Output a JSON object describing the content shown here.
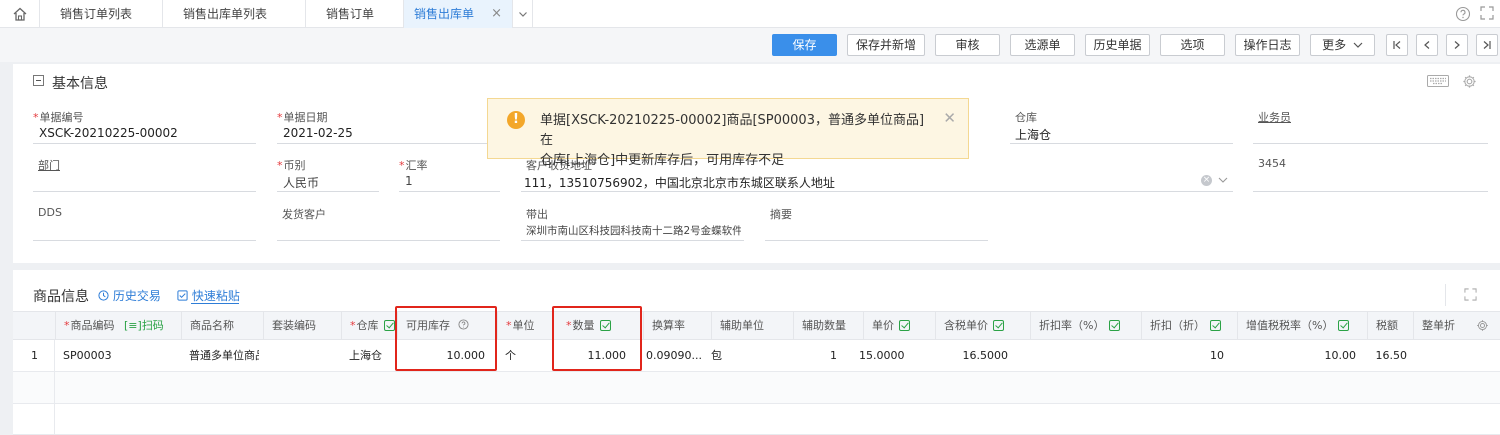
{
  "tabs": [
    {
      "label": "销售订单列表"
    },
    {
      "label": "销售出库单列表"
    },
    {
      "label": "销售订单"
    },
    {
      "label": "销售出库单",
      "close": "×"
    }
  ],
  "toolbar": {
    "save": "保存",
    "save_new": "保存并新增",
    "audit": "审核",
    "select_source": "选源单",
    "history_docs": "历史单据",
    "options": "选项",
    "op_log": "操作日志",
    "more": "更多"
  },
  "basic": {
    "title": "基本信息",
    "fields": {
      "doc_no": {
        "label": "单据编号",
        "value": "XSCK-20210225-00002"
      },
      "doc_date": {
        "label": "单据日期",
        "value": "2021-02-25"
      },
      "warehouse": {
        "label": "仓库",
        "value": "上海仓"
      },
      "salesman": {
        "label": "业务员",
        "value": ""
      },
      "dept": {
        "label": "部门",
        "value": ""
      },
      "currency": {
        "label": "币别",
        "value": "人民币"
      },
      "rate": {
        "label": "汇率",
        "value": "1"
      },
      "address": {
        "label": "客户收货地址",
        "value": "111，13510756902，中国北京北京市东城区联系人地址"
      },
      "custom1": {
        "label": "3454",
        "value": ""
      },
      "dds": {
        "label": "DDS",
        "value": ""
      },
      "ship_customer": {
        "label": "发货客户",
        "value": ""
      },
      "bring_out": {
        "label": "带出",
        "value": "深圳市南山区科技园科技南十二路2号金蝶软件..."
      },
      "summary": {
        "label": "摘要",
        "value": ""
      }
    }
  },
  "alert": {
    "line1": "单据[XSCK-20210225-00002]商品[SP00003，普通多单位商品]在",
    "line2": "仓库[上海仓]中更新库存后，可用库存不足"
  },
  "goods": {
    "title": "商品信息",
    "history_trade": "历史交易",
    "quick_paste": "快速粘贴",
    "columns": {
      "code": "商品编码",
      "scan": "扫码",
      "name": "商品名称",
      "set_code": "套装编码",
      "warehouse": "仓库",
      "avail_stock": "可用库存",
      "unit": "单位",
      "qty": "数量",
      "conv_rate": "换算率",
      "aux_unit": "辅助单位",
      "aux_qty": "辅助数量",
      "price": "单价",
      "tax_price": "含税单价",
      "discount_rate": "折扣率（%）",
      "discount": "折扣（折）",
      "vat_rate": "增值税税率（%）",
      "tax_amount": "税额",
      "whole_disc": "整单折"
    },
    "rows": [
      {
        "idx": "1",
        "code": "SP00003",
        "name": "普通多单位商品",
        "warehouse": "上海仓",
        "avail_stock": "10.000",
        "unit": "个",
        "qty": "11.000",
        "conv_rate": "0.09090...",
        "aux_unit": "包",
        "aux_qty": "1",
        "price": "15.0000",
        "tax_price": "16.5000",
        "discount": "10",
        "vat_rate": "10.00",
        "tax_amount": "16.50"
      }
    ]
  }
}
